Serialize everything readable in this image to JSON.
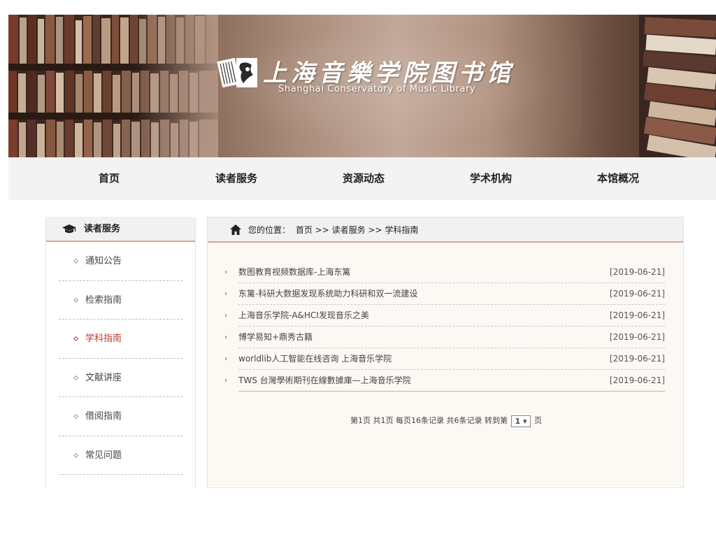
{
  "banner": {
    "title_cn": "上海音樂学院图书馆",
    "title_en": "Shanghai Conservatory of Music Library"
  },
  "nav": {
    "items": [
      {
        "label": "首页"
      },
      {
        "label": "读者服务"
      },
      {
        "label": "资源动态"
      },
      {
        "label": "学术机构"
      },
      {
        "label": "本馆概况"
      }
    ]
  },
  "sidebar": {
    "title": "读者服务",
    "items": [
      {
        "label": "通知公告",
        "active": false
      },
      {
        "label": "检索指南",
        "active": false
      },
      {
        "label": "学科指南",
        "active": true
      },
      {
        "label": "文献讲座",
        "active": false
      },
      {
        "label": "借阅指南",
        "active": false
      },
      {
        "label": "常见问题",
        "active": false
      }
    ],
    "accent_color": "#c0362c"
  },
  "breadcrumb": {
    "prefix": "您的位置：",
    "path": "首页 >> 读者服务 >> 学科指南"
  },
  "articles": [
    {
      "title": "数图教育视频数据库-上海东篱",
      "date": "[2019-06-21]"
    },
    {
      "title": "东篱-科研大数据发现系统助力科研和双一流建设",
      "date": "[2019-06-21]"
    },
    {
      "title": "上海音乐学院-A&HCI发现音乐之美",
      "date": "[2019-06-21]"
    },
    {
      "title": "博学易知+鼎秀古籍",
      "date": "[2019-06-21]"
    },
    {
      "title": "worldlib人工智能在线咨询 上海音乐学院",
      "date": "[2019-06-21]"
    },
    {
      "title": "TWS 台灣學術期刊在線數據庫—上海音乐学院",
      "date": "[2019-06-21]"
    }
  ],
  "pager": {
    "summary": "第1页 共1页 每页16条记录 共6条记录 转到第",
    "page_value": "1 ▾",
    "suffix": "页"
  }
}
